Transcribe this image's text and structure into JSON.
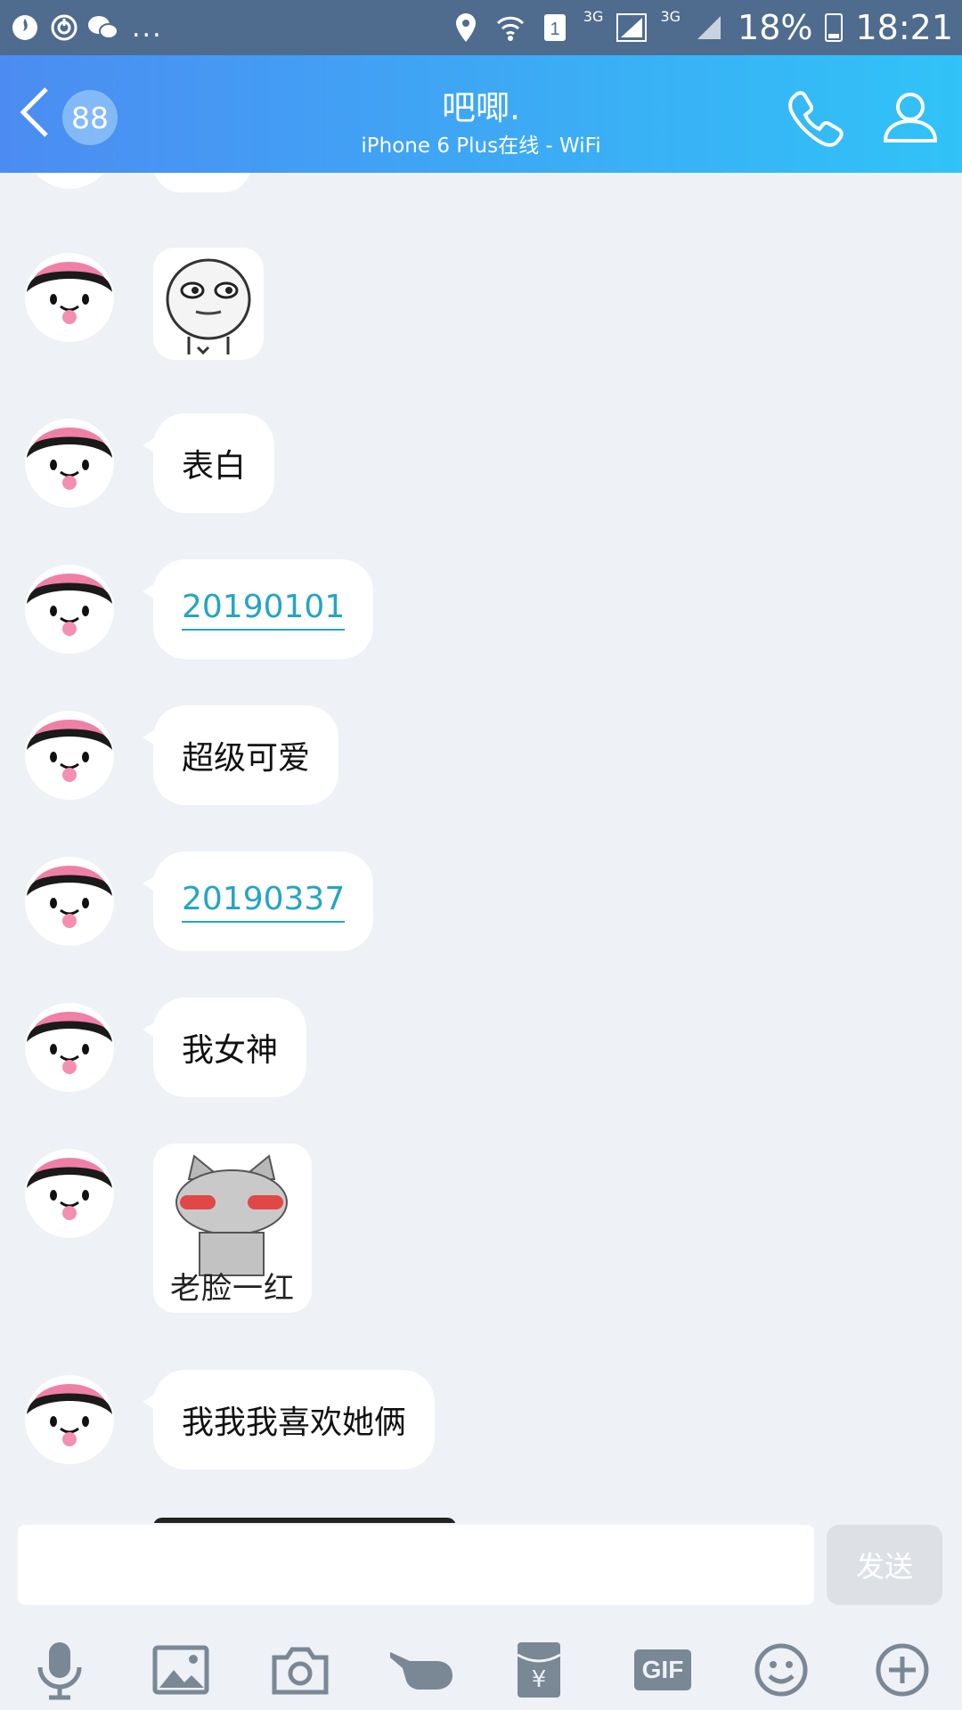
{
  "status_bar": {
    "network_1": "3G",
    "network_2": "3G",
    "battery": "18%",
    "time": "18:21",
    "more": "..."
  },
  "header": {
    "unread_count": "88",
    "title": "吧唧.",
    "subtitle": "iPhone 6 Plus在线 - WiFi"
  },
  "messages": [
    {
      "type": "text",
      "text": "表白"
    },
    {
      "type": "link",
      "text": "20190101"
    },
    {
      "type": "text",
      "text": "超级可爱"
    },
    {
      "type": "link",
      "text": "20190337"
    },
    {
      "type": "text",
      "text": "我女神"
    },
    {
      "type": "sticker",
      "caption": "老脸一红"
    },
    {
      "type": "text",
      "text": "我我我喜欢她俩"
    }
  ],
  "composer": {
    "send_label": "发送",
    "gif_label": "GIF"
  },
  "colors": {
    "header_start": "#4c8cf2",
    "header_end": "#30c3f7",
    "link": "#24a5c4",
    "status_bar": "#4f6c8e"
  }
}
